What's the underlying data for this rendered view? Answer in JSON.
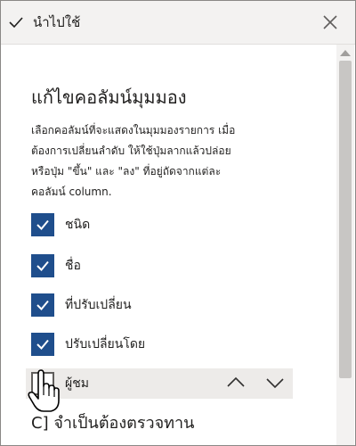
{
  "header": {
    "apply_label": "นำไปใช้"
  },
  "panel": {
    "heading": "แก้ไขคอลัมน์มุมมอง",
    "description": "เลือกคอลัมน์ที่จะแสดงในมุมมองรายการ เมื่อต้องการเปลี่ยนลำดับ ให้ใช้ปุ่มลากแล้วปล่อย หรือปุ่ม \"ขึ้น\" และ \"ลง\" ที่อยู่ถัดจากแต่ละคอลัมน์ column."
  },
  "columns": [
    {
      "label": "ชนิด",
      "checked": true
    },
    {
      "label": "ชื่อ",
      "checked": true
    },
    {
      "label": "ที่ปรับเปลี่ยน",
      "checked": true
    },
    {
      "label": "ปรับเปลี่ยนโดย",
      "checked": true
    },
    {
      "label": "ผู้ชม",
      "checked": false
    }
  ],
  "partial_item": {
    "label": "C] จำเป็นต้องตรวจทาน"
  },
  "icons": {
    "apply": "check-icon",
    "close": "close-icon",
    "move_up": "chevron-up-icon",
    "move_down": "chevron-down-icon"
  },
  "colors": {
    "checkbox_checked": "#1f4e8c",
    "header_bg": "#f3f2f1",
    "hover_row": "#edebe9"
  }
}
